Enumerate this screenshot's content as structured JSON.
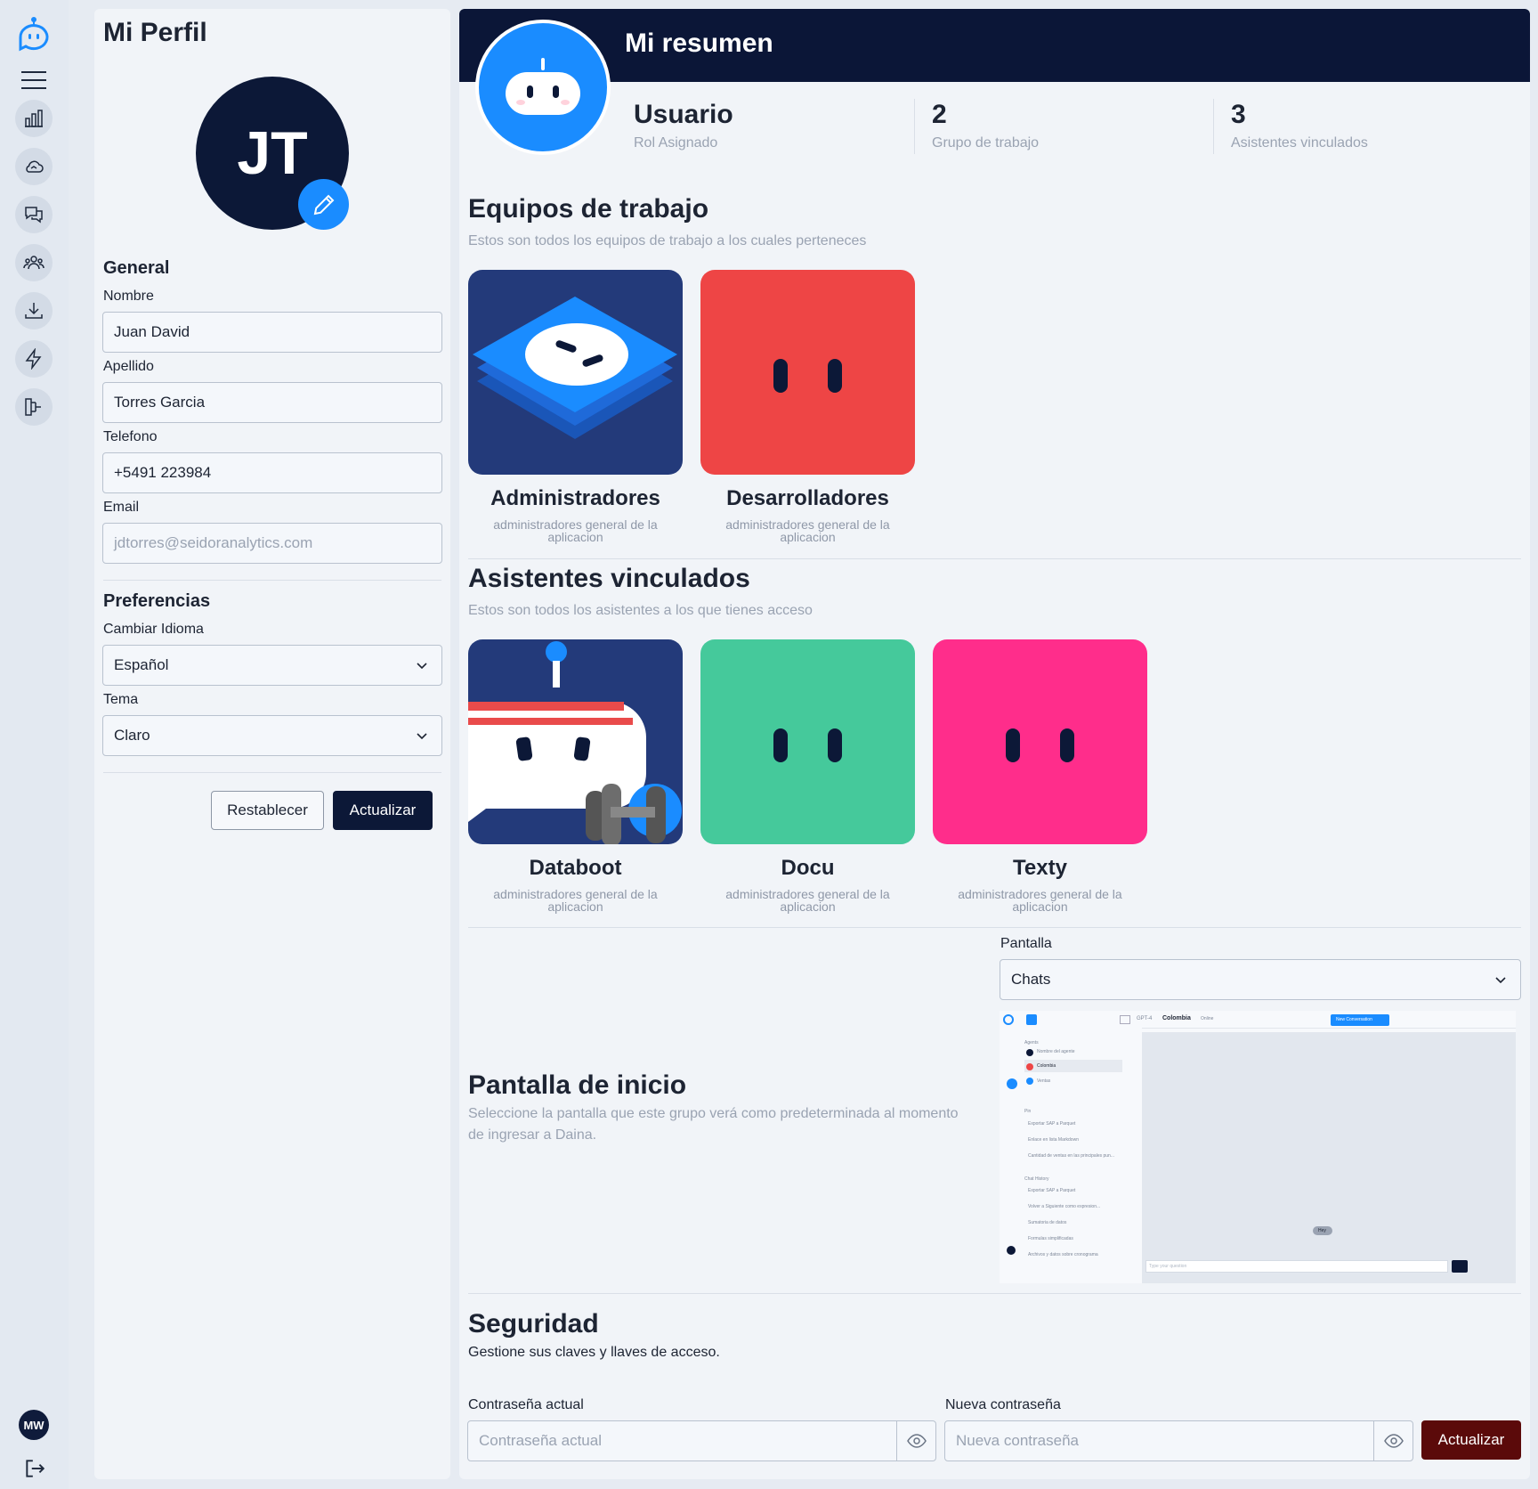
{
  "sidebar": {
    "logo_icon": "bot-logo-icon",
    "items": [
      {
        "name": "menu-icon"
      },
      {
        "name": "chart-icon"
      },
      {
        "name": "cloud-icon"
      },
      {
        "name": "chat-icon"
      },
      {
        "name": "users-icon"
      },
      {
        "name": "download-icon"
      },
      {
        "name": "lightning-icon"
      },
      {
        "name": "workflow-icon"
      }
    ],
    "avatar_initials": "MW",
    "logout_icon": "logout-icon"
  },
  "profile": {
    "title": "Mi Perfil",
    "avatar_initials": "JT",
    "general": {
      "heading": "General",
      "nombre_label": "Nombre",
      "nombre_value": "Juan David",
      "apellido_label": "Apellido",
      "apellido_value": "Torres Garcia",
      "telefono_label": "Telefono",
      "telefono_value": "+5491 223984",
      "email_label": "Email",
      "email_value": "jdtorres@seidoranalytics.com"
    },
    "preferences": {
      "heading": "Preferencias",
      "idioma_label": "Cambiar Idioma",
      "idioma_value": "Español",
      "tema_label": "Tema",
      "tema_value": "Claro"
    },
    "reset_label": "Restablecer",
    "update_label": "Actualizar"
  },
  "summary": {
    "title": "Mi resumen",
    "stats": [
      {
        "value": "Usuario",
        "label": "Rol Asignado"
      },
      {
        "value": "2",
        "label": "Grupo de trabajo"
      },
      {
        "value": "3",
        "label": "Asistentes vinculados"
      }
    ],
    "teams": {
      "heading": "Equipos de trabajo",
      "subtitle": "Estos son todos los equipos de trabajo a los cuales perteneces",
      "items": [
        {
          "name": "Administradores",
          "desc": "administradores general de la aplicacion",
          "color": "#233a7a"
        },
        {
          "name": "Desarrolladores",
          "desc": "administradores general de la aplicacion",
          "color": "#ee4545"
        }
      ]
    },
    "assistants": {
      "heading": "Asistentes vinculados",
      "subtitle": "Estos son todos los asistentes a los que tienes acceso",
      "items": [
        {
          "name": "Databoot",
          "desc": "administradores general de la aplicacion",
          "color": "#233a7a"
        },
        {
          "name": "Docu",
          "desc": "administradores general de la aplicacion",
          "color": "#45c99b"
        },
        {
          "name": "Texty",
          "desc": "administradores general de la aplicacion",
          "color": "#ff2d8b"
        }
      ]
    },
    "home": {
      "heading": "Pantalla de inicio",
      "description": "Seleccione la pantalla que este grupo verá como predeterminada al momento de ingresar a Daina.",
      "screen_label": "Pantalla",
      "screen_value": "Chats",
      "preview": {
        "model": "GPT-4",
        "title": "Colombia",
        "title_sub": "Online",
        "new_conv": "New Conversation",
        "agents_label": "Agents",
        "agents": [
          "Nombre del agente",
          "Colombia",
          "Ventas"
        ],
        "pin_label": "Pin",
        "pins": [
          "Exportar SAP a Parquet",
          "Enlace en lista Markdown",
          "Cantidad de ventas en las principales pun..."
        ],
        "history_label": "Chat History",
        "history": [
          "Exportar SAP a Parquet",
          "Volver a Siguiente como expresion...",
          "Sumatoria de datos",
          "Formulas simplificadas",
          "Archivos y datos sobre cronograma"
        ],
        "hey": "Hey",
        "input_placeholder": "Type your question"
      }
    },
    "security": {
      "heading": "Seguridad",
      "subtitle": "Gestione sus claves y llaves de acceso.",
      "current_label": "Contraseña actual",
      "current_placeholder": "Contraseña actual",
      "new_label": "Nueva contraseña",
      "new_placeholder": "Nueva contraseña",
      "update_label": "Actualizar"
    }
  }
}
